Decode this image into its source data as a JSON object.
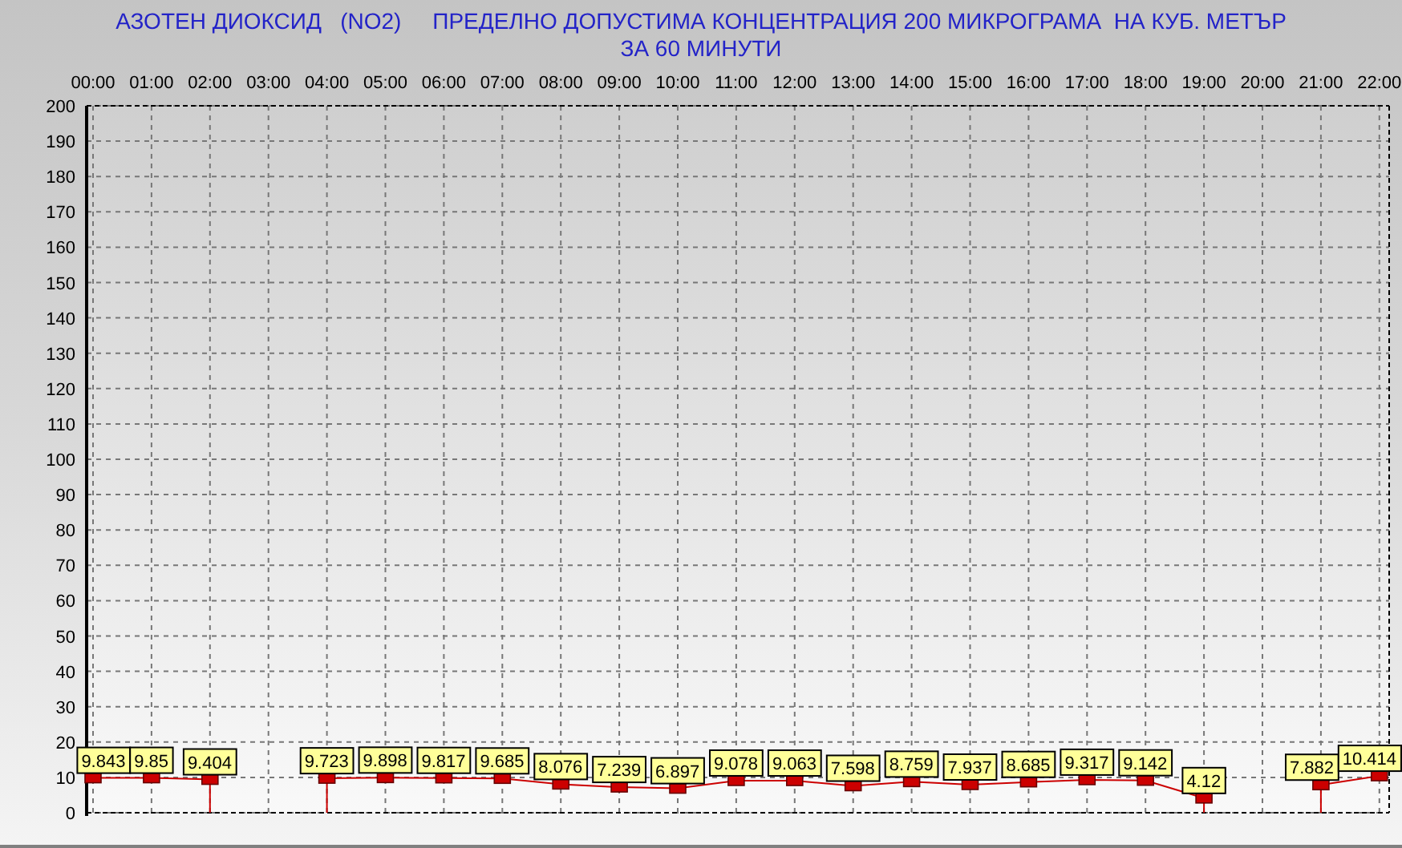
{
  "title": {
    "line_1": "АЗОТЕН ДИОКСИД   (NO2)     ПРЕДЕЛНО ДОПУСТИМА КОНЦЕНТРАЦИЯ 200 МИКРОГРАМА  НА КУБ. МЕТЪР",
    "line_2": "ЗА 60 МИНУТИ"
  },
  "chart_data": {
    "type": "line",
    "categories": [
      "00:00",
      "01:00",
      "02:00",
      "03:00",
      "04:00",
      "05:00",
      "06:00",
      "07:00",
      "08:00",
      "09:00",
      "10:00",
      "11:00",
      "12:00",
      "13:00",
      "14:00",
      "15:00",
      "16:00",
      "17:00",
      "18:00",
      "19:00",
      "20:00",
      "21:00",
      "22:00"
    ],
    "series": [
      {
        "color": "#cc0000",
        "marker": "square",
        "values": [
          9.843,
          9.85,
          9.404,
          null,
          9.723,
          9.898,
          9.817,
          9.685,
          8.076,
          7.239,
          6.897,
          9.078,
          9.063,
          7.598,
          8.759,
          7.937,
          8.685,
          9.317,
          9.142,
          4.12,
          null,
          7.882,
          10.414
        ]
      }
    ],
    "value_labels": [
      "9.843",
      "9.85",
      "9.404",
      null,
      "9.723",
      "9.898",
      "9.817",
      "9.685",
      "8.076",
      "7.239",
      "6.897",
      "9.078",
      "9.063",
      "7.598",
      "8.759",
      "7.937",
      "8.685",
      "9.317",
      "9.142",
      "4.12",
      null,
      "7.882",
      "10.414"
    ],
    "grid": true,
    "ylim": [
      0,
      200
    ],
    "yticks": [
      0,
      10,
      20,
      30,
      40,
      50,
      60,
      70,
      80,
      90,
      100,
      110,
      120,
      130,
      140,
      150,
      160,
      170,
      180,
      190,
      200
    ]
  }
}
